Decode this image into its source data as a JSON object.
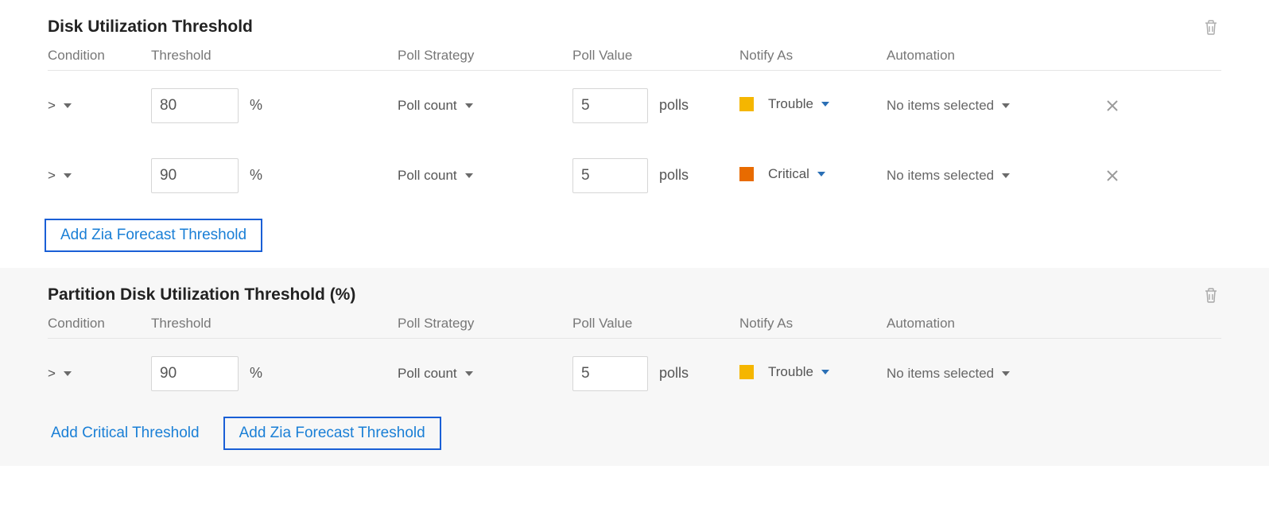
{
  "sections": [
    {
      "title": "Disk Utilization Threshold",
      "headers": {
        "condition": "Condition",
        "threshold": "Threshold",
        "poll_strategy": "Poll Strategy",
        "poll_value": "Poll Value",
        "notify_as": "Notify As",
        "automation": "Automation"
      },
      "rows": [
        {
          "condition": ">",
          "threshold": "80",
          "threshold_unit": "%",
          "poll_strategy": "Poll count",
          "poll_value": "5",
          "poll_unit": "polls",
          "notify_label": "Trouble",
          "notify_color": "yellow",
          "automation": "No items selected",
          "deletable": true
        },
        {
          "condition": ">",
          "threshold": "90",
          "threshold_unit": "%",
          "poll_strategy": "Poll count",
          "poll_value": "5",
          "poll_unit": "polls",
          "notify_label": "Critical",
          "notify_color": "orange",
          "automation": "No items selected",
          "deletable": true
        }
      ],
      "links": [
        {
          "label": "Add Zia Forecast Threshold",
          "boxed": true
        }
      ]
    },
    {
      "title": "Partition Disk Utilization Threshold (%)",
      "headers": {
        "condition": "Condition",
        "threshold": "Threshold",
        "poll_strategy": "Poll Strategy",
        "poll_value": "Poll Value",
        "notify_as": "Notify As",
        "automation": "Automation"
      },
      "rows": [
        {
          "condition": ">",
          "threshold": "90",
          "threshold_unit": "%",
          "poll_strategy": "Poll count",
          "poll_value": "5",
          "poll_unit": "polls",
          "notify_label": "Trouble",
          "notify_color": "yellow",
          "automation": "No items selected",
          "deletable": false
        }
      ],
      "links": [
        {
          "label": "Add Critical Threshold",
          "boxed": false
        },
        {
          "label": "Add Zia Forecast Threshold",
          "boxed": true
        }
      ]
    }
  ]
}
